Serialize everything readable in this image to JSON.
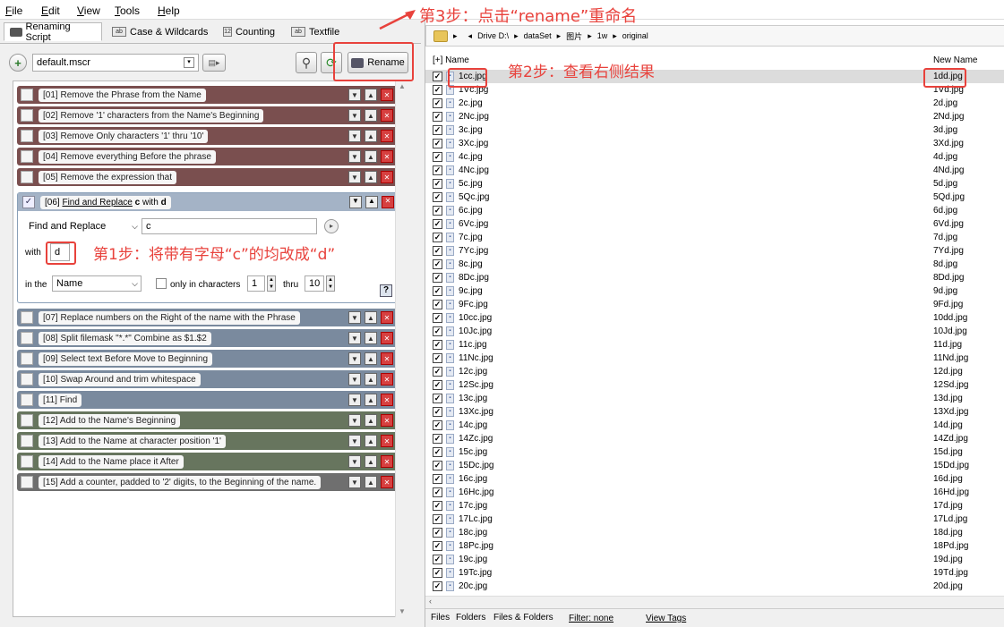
{
  "menu": [
    "File",
    "Edit",
    "View",
    "Tools",
    "Help"
  ],
  "tabs": [
    {
      "label": "Renaming Script"
    },
    {
      "label": "Case & Wildcards"
    },
    {
      "label": "Counting"
    },
    {
      "label": "Textfile"
    }
  ],
  "script": {
    "file": "default.mscr",
    "rename_label": "Rename"
  },
  "rules_top": [
    {
      "num": "[01]",
      "text": "Remove the Phrase  from the Name"
    },
    {
      "num": "[02]",
      "text": "Remove '1' characters from the Name's Beginning"
    },
    {
      "num": "[03]",
      "text": "Remove Only characters '1' thru '10'"
    },
    {
      "num": "[04]",
      "text": "Remove everything Before the phrase"
    },
    {
      "num": "[05]",
      "text": "Remove the expression that"
    }
  ],
  "rule06": {
    "num": "[06]",
    "text_pre": "Find and Replace",
    "text_c": "c",
    "text_mid": "with",
    "text_d": "d",
    "mode": "Find and Replace",
    "find_value": "c",
    "with_label": "with",
    "with_value": "d",
    "in_the_label": "in the",
    "in_the_value": "Name",
    "only_in_chars": "only in characters",
    "from_value": "1",
    "thru_label": "thru",
    "thru_value": "10",
    "help": "?"
  },
  "rules_bottom": [
    {
      "num": "[07]",
      "text": "Replace numbers on the Right of the name with  the Phrase"
    },
    {
      "num": "[08]",
      "text": "Split filemask \"*.*\" Combine as $1.$2"
    },
    {
      "num": "[09]",
      "text": "Select text Before  Move to Beginning"
    },
    {
      "num": "[10]",
      "text": "Swap Around  and trim whitespace"
    },
    {
      "num": "[11]",
      "text": "Find"
    },
    {
      "num": "[12]",
      "text": "Add  to the Name's Beginning"
    },
    {
      "num": "[13]",
      "text": "Add  to the Name at character position '1'"
    },
    {
      "num": "[14]",
      "text": "Add  to the Name place it After"
    },
    {
      "num": "[15]",
      "text": "Add a counter,  padded to  '2' digits, to the Beginning of the name."
    }
  ],
  "annotations": {
    "step1": "第1步：将带有字母“c”的均改成“d”",
    "step2": "第2步：查看右侧结果",
    "step3": "第3步：点击“rename”重命名"
  },
  "path": [
    "Drive D:\\",
    "dataSet",
    "图片",
    "1w",
    "original"
  ],
  "list": {
    "col_name": "[+] Name",
    "col_new": "New Name",
    "files": [
      {
        "name": "1cc.jpg",
        "new": "1dd.jpg"
      },
      {
        "name": "1Vc.jpg",
        "new": "1Vd.jpg"
      },
      {
        "name": "2c.jpg",
        "new": "2d.jpg"
      },
      {
        "name": "2Nc.jpg",
        "new": "2Nd.jpg"
      },
      {
        "name": "3c.jpg",
        "new": "3d.jpg"
      },
      {
        "name": "3Xc.jpg",
        "new": "3Xd.jpg"
      },
      {
        "name": "4c.jpg",
        "new": "4d.jpg"
      },
      {
        "name": "4Nc.jpg",
        "new": "4Nd.jpg"
      },
      {
        "name": "5c.jpg",
        "new": "5d.jpg"
      },
      {
        "name": "5Qc.jpg",
        "new": "5Qd.jpg"
      },
      {
        "name": "6c.jpg",
        "new": "6d.jpg"
      },
      {
        "name": "6Vc.jpg",
        "new": "6Vd.jpg"
      },
      {
        "name": "7c.jpg",
        "new": "7d.jpg"
      },
      {
        "name": "7Yc.jpg",
        "new": "7Yd.jpg"
      },
      {
        "name": "8c.jpg",
        "new": "8d.jpg"
      },
      {
        "name": "8Dc.jpg",
        "new": "8Dd.jpg"
      },
      {
        "name": "9c.jpg",
        "new": "9d.jpg"
      },
      {
        "name": "9Fc.jpg",
        "new": "9Fd.jpg"
      },
      {
        "name": "10cc.jpg",
        "new": "10dd.jpg"
      },
      {
        "name": "10Jc.jpg",
        "new": "10Jd.jpg"
      },
      {
        "name": "11c.jpg",
        "new": "11d.jpg"
      },
      {
        "name": "11Nc.jpg",
        "new": "11Nd.jpg"
      },
      {
        "name": "12c.jpg",
        "new": "12d.jpg"
      },
      {
        "name": "12Sc.jpg",
        "new": "12Sd.jpg"
      },
      {
        "name": "13c.jpg",
        "new": "13d.jpg"
      },
      {
        "name": "13Xc.jpg",
        "new": "13Xd.jpg"
      },
      {
        "name": "14c.jpg",
        "new": "14d.jpg"
      },
      {
        "name": "14Zc.jpg",
        "new": "14Zd.jpg"
      },
      {
        "name": "15c.jpg",
        "new": "15d.jpg"
      },
      {
        "name": "15Dc.jpg",
        "new": "15Dd.jpg"
      },
      {
        "name": "16c.jpg",
        "new": "16d.jpg"
      },
      {
        "name": "16Hc.jpg",
        "new": "16Hd.jpg"
      },
      {
        "name": "17c.jpg",
        "new": "17d.jpg"
      },
      {
        "name": "17Lc.jpg",
        "new": "17Ld.jpg"
      },
      {
        "name": "18c.jpg",
        "new": "18d.jpg"
      },
      {
        "name": "18Pc.jpg",
        "new": "18Pd.jpg"
      },
      {
        "name": "19c.jpg",
        "new": "19d.jpg"
      },
      {
        "name": "19Tc.jpg",
        "new": "19Td.jpg"
      },
      {
        "name": "20c.jpg",
        "new": "20d.jpg"
      }
    ]
  },
  "bottom": {
    "tab_files": "Files",
    "tab_folders": "Folders",
    "tab_both": "Files & Folders",
    "filter": "Filter:  none",
    "view_tags": "View Tags"
  },
  "colors": {
    "annotation": "#e8423c",
    "selected_row": "#dcdcdc"
  }
}
